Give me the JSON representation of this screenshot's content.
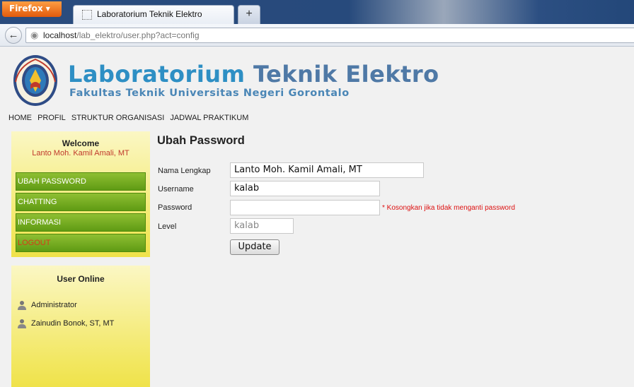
{
  "browser": {
    "app_button": "Firefox ▾",
    "tab_title": "Laboratorium Teknik Elektro",
    "new_tab": "+",
    "url_host": "localhost",
    "url_path": "/lab_elektro/user.php?act=config"
  },
  "header": {
    "title_part1": "Laboratorium",
    "title_part2": "Teknik Elektro",
    "subtitle": "Fakultas Teknik Universitas Negeri Gorontalo"
  },
  "top_menu": [
    "HOME",
    "PROFIL",
    "STRUKTUR ORGANISASI",
    "JADWAL PRAKTIKUM"
  ],
  "sidebar": {
    "welcome_title": "Welcome",
    "welcome_name": "Lanto Moh. Kamil Amali, MT",
    "menu": [
      {
        "label": "UBAH PASSWORD"
      },
      {
        "label": "CHATTING"
      },
      {
        "label": "INFORMASI"
      },
      {
        "label": "LOGOUT"
      }
    ],
    "online_title": "User Online",
    "online_users": [
      "Administrator",
      "Zainudin Bonok, ST, MT"
    ]
  },
  "form": {
    "title": "Ubah Password",
    "labels": {
      "full_name": "Nama Lengkap",
      "username": "Username",
      "password": "Password",
      "level": "Level"
    },
    "values": {
      "full_name": "Lanto Moh. Kamil Amali, MT",
      "username": "kalab",
      "password": "",
      "level": "kalab"
    },
    "password_hint": "* Kosongkan jika tidak menganti password",
    "submit": "Update"
  },
  "colors": {
    "brand_blue": "#2e8fc4",
    "menu_green": "#6ea81c",
    "sidebar_yellow": "#f2e760",
    "alert_red": "#d11111"
  }
}
